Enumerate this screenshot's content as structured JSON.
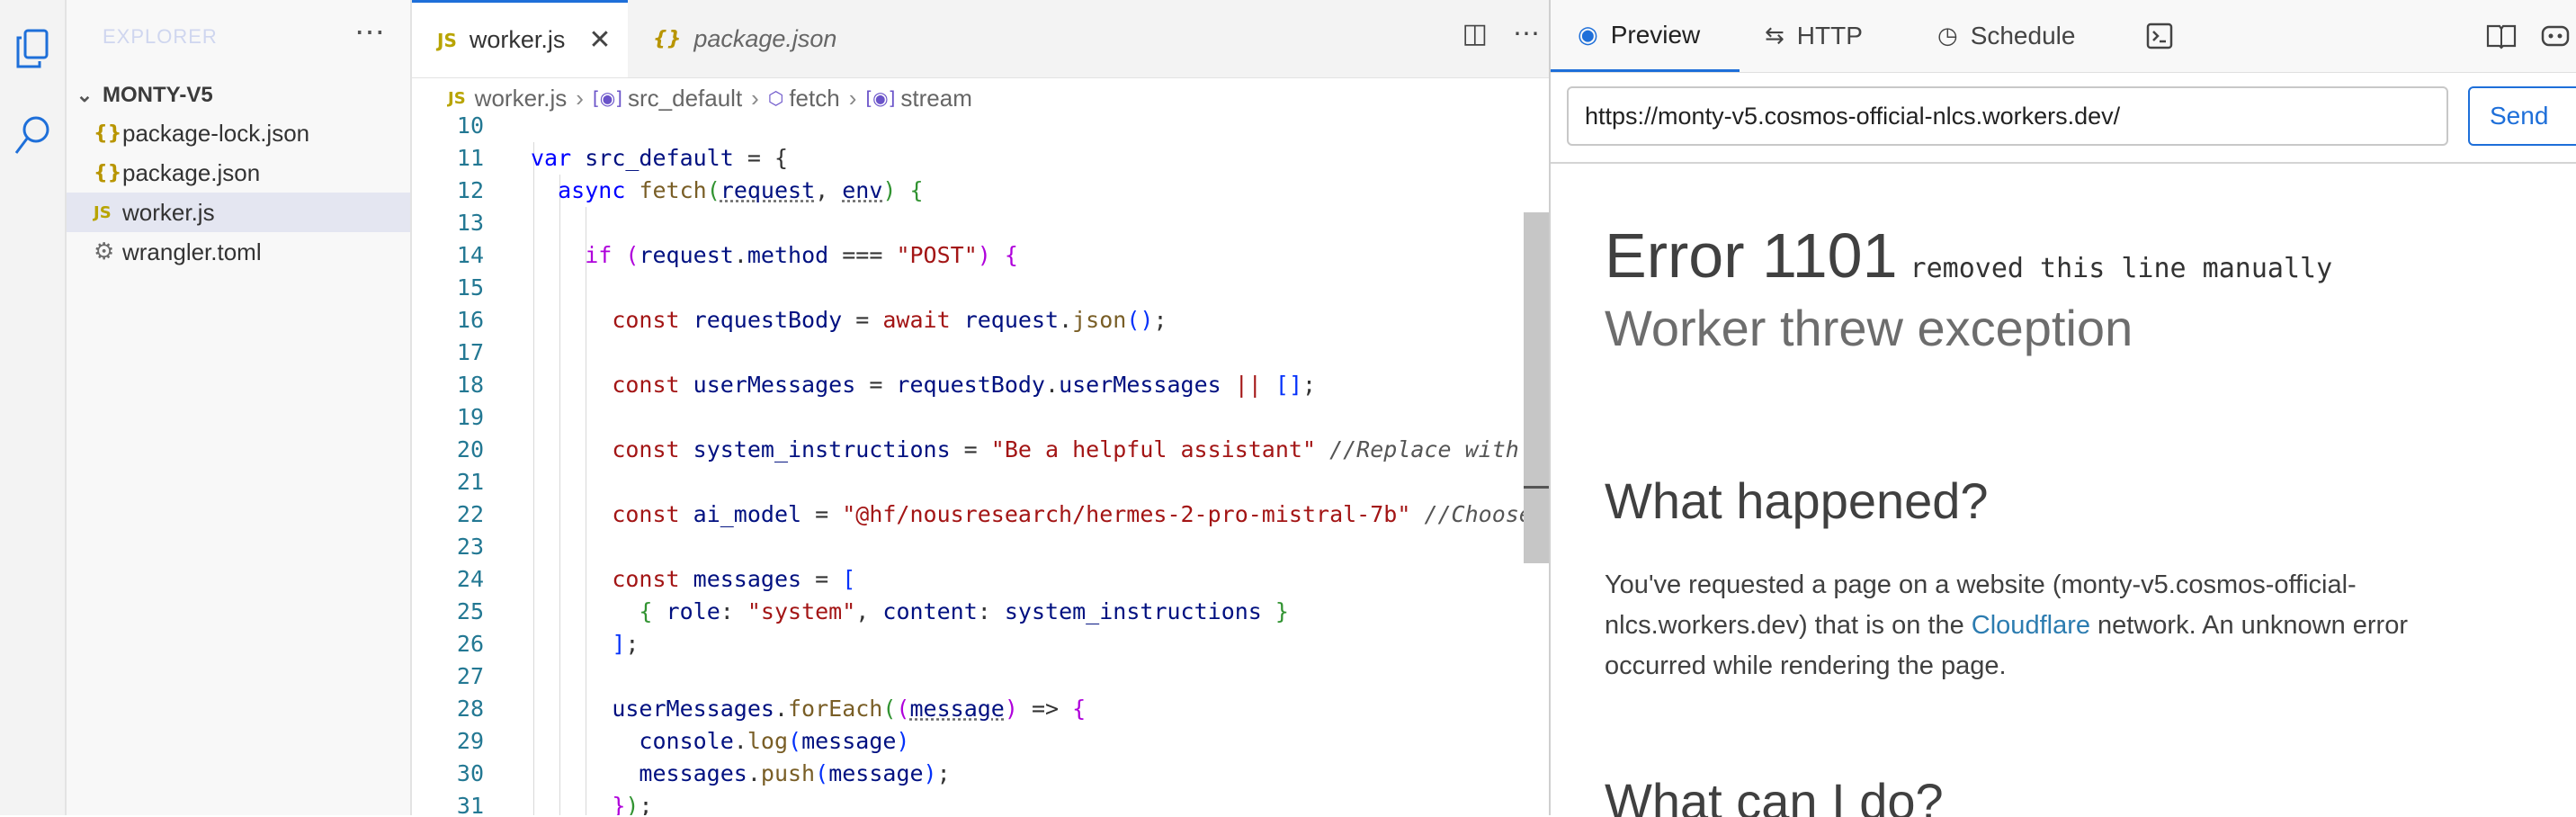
{
  "explorer": {
    "title": "EXPLORER",
    "project": "MONTY-V5",
    "files": [
      {
        "name": "package-lock.json",
        "icon": "json-icon"
      },
      {
        "name": "package.json",
        "icon": "json-icon"
      },
      {
        "name": "worker.js",
        "icon": "js-icon",
        "selected": true
      },
      {
        "name": "wrangler.toml",
        "icon": "gear-icon"
      }
    ]
  },
  "editor": {
    "tabs": [
      {
        "label": "worker.js",
        "active": true
      },
      {
        "label": "package.json",
        "active": false
      }
    ],
    "breadcrumb": [
      "worker.js",
      "src_default",
      "fetch",
      "stream"
    ],
    "line_numbers": [
      "10",
      "11",
      "12",
      "13",
      "14",
      "15",
      "16",
      "17",
      "18",
      "19",
      "20",
      "21",
      "22",
      "23",
      "24",
      "25",
      "26",
      "27",
      "28",
      "29",
      "30",
      "31"
    ],
    "code": {
      "l11_kw": "var",
      "l11_name": "src_default",
      "l11_rest": " = {",
      "l12_kw": "async",
      "l12_fn": "fetch",
      "l12_p1": "request",
      "l12_p2": "env",
      "l14_kw": "if",
      "l14_obj": "request",
      "l14_prop": "method",
      "l14_str": "\"POST\"",
      "l16_kw": "const",
      "l16_var": "requestBody",
      "l16_kw2": "await",
      "l16_obj": "request",
      "l16_fn": "json",
      "l18_kw": "const",
      "l18_var": "userMessages",
      "l18_obj": "requestBody",
      "l18_prop": "userMessages",
      "l20_kw": "const",
      "l20_var": "system_instructions",
      "l20_str": "\"Be a helpful assistant\"",
      "l20_cmt": "//Replace with you",
      "l22_kw": "const",
      "l22_var": "ai_model",
      "l22_str": "\"@hf/nousresearch/hermes-2-pro-mistral-7b\"",
      "l22_cmt": "//Choose an",
      "l24_kw": "const",
      "l24_var": "messages",
      "l25_role": "role",
      "l25_str": "\"system\"",
      "l25_content": "content",
      "l25_val": "system_instructions",
      "l28_obj": "userMessages",
      "l28_fn": "forEach",
      "l28_param": "message",
      "l29_obj": "console",
      "l29_fn": "log",
      "l29_arg": "message",
      "l30_obj": "messages",
      "l30_fn": "push",
      "l30_arg": "message"
    }
  },
  "panel": {
    "tabs": [
      {
        "label": "Preview",
        "icon": "eye-icon"
      },
      {
        "label": "HTTP",
        "icon": "arrows-icon"
      },
      {
        "label": "Schedule",
        "icon": "clock-icon"
      }
    ],
    "url": "https://monty-v5.cosmos-official-nlcs.workers.dev/",
    "send_label": "Send",
    "preview": {
      "error_code": "Error 1101",
      "error_note": "removed this line manually",
      "error_title": "Worker threw exception",
      "what_happened": "What happened?",
      "happened_text_1": "You've requested a page on a website (monty-v5.cosmos-official-nlcs.workers.dev) that is on the ",
      "happened_link": "Cloudflare",
      "happened_text_2": " network. An unknown error occurred while rendering the page.",
      "what_can_i_do": "What can I do?"
    }
  },
  "colors": {
    "accent": "#1e6fd9",
    "keyword": "#0000ff",
    "string": "#a31515",
    "comment": "#008000",
    "variable": "#001080",
    "line_number": "#237893"
  }
}
